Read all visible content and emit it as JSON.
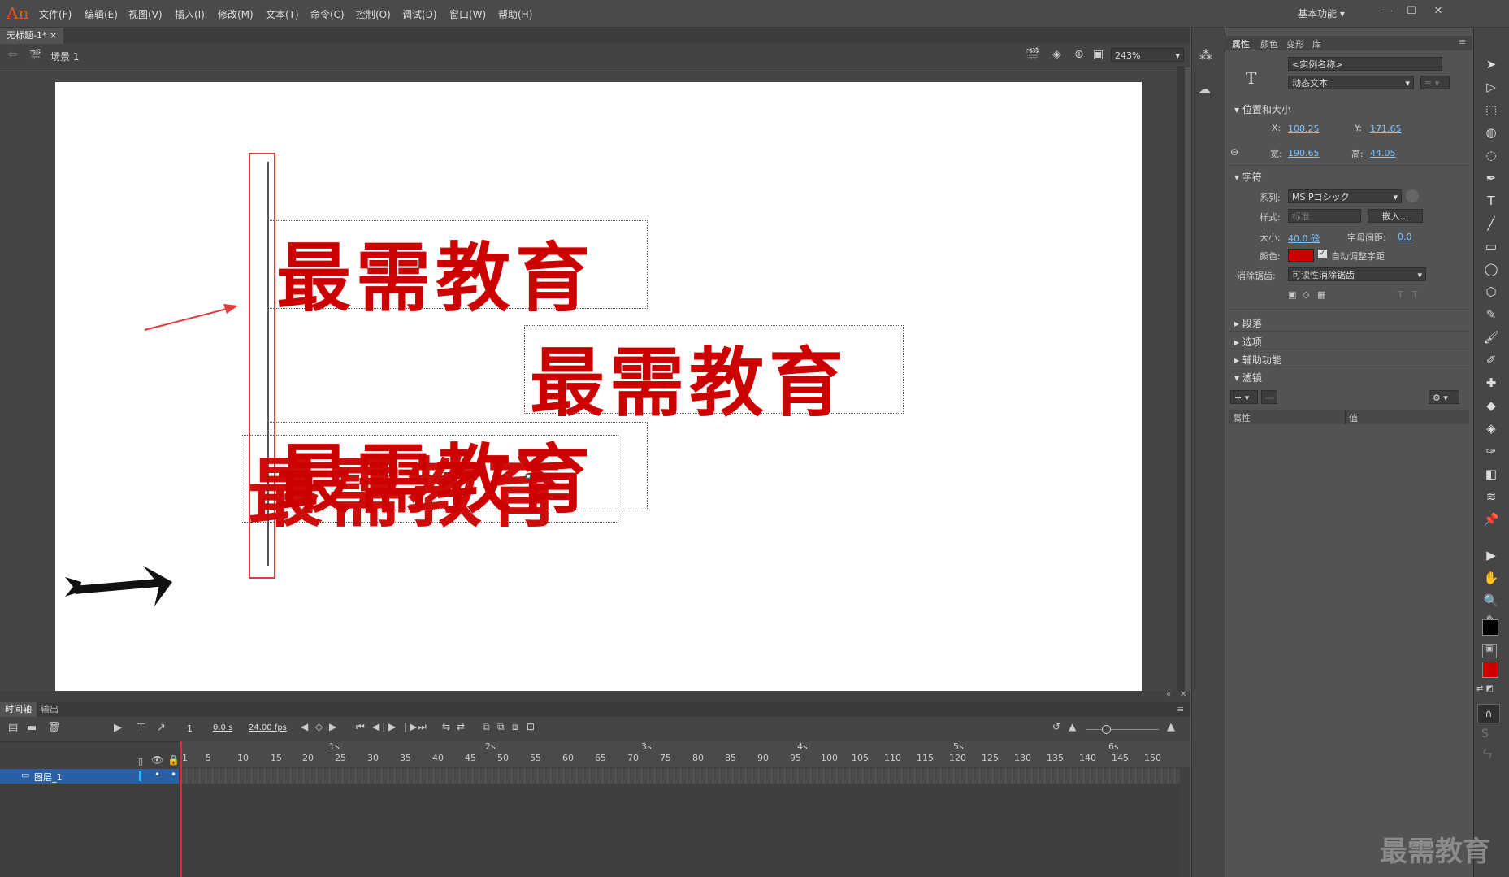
{
  "app": {
    "logo": "An"
  },
  "menu": [
    "文件(F)",
    "编辑(E)",
    "视图(V)",
    "插入(I)",
    "修改(M)",
    "文本(T)",
    "命令(C)",
    "控制(O)",
    "调试(D)",
    "窗口(W)",
    "帮助(H)"
  ],
  "workspace": "基本功能",
  "document": {
    "tab": "无标题-1*",
    "scene": "场景 1",
    "zoom": "243%"
  },
  "stage": {
    "text": "最需教育"
  },
  "timeline": {
    "tabs": [
      "时间轴",
      "输出"
    ],
    "frame": "1",
    "time": "0.0 s",
    "fps": "24.00 fps",
    "seconds": [
      "1s",
      "2s",
      "3s",
      "4s",
      "5s",
      "6s"
    ],
    "frame_ticks": [
      "1",
      "5",
      "10",
      "15",
      "20",
      "25",
      "30",
      "35",
      "40",
      "45",
      "50",
      "55",
      "60",
      "65",
      "70",
      "75",
      "80",
      "85",
      "90",
      "95",
      "100",
      "105",
      "110",
      "115",
      "120",
      "125",
      "130",
      "135",
      "140",
      "145",
      "150"
    ],
    "layer": "图层_1"
  },
  "panel": {
    "tabs": [
      "属性",
      "颜色",
      "变形",
      "库"
    ],
    "instance_name": "<实例名称>",
    "text_type": "动态文本",
    "pos_size": {
      "title": "位置和大小",
      "x_label": "X:",
      "x": "108.25",
      "y_label": "Y:",
      "y": "171.65",
      "w_label": "宽:",
      "w": "190.65",
      "h_label": "高:",
      "h": "44.05"
    },
    "char": {
      "title": "字符",
      "family_label": "系列:",
      "family": "MS Pゴシック",
      "style_label": "样式:",
      "style": "标准",
      "embed": "嵌入...",
      "size_label": "大小:",
      "size": "40.0 磅",
      "spacing_label": "字母间距:",
      "spacing": "0.0",
      "color_label": "颜色:",
      "color": "#cc0000",
      "autokern": "自动调整字距",
      "aa_label": "消除锯齿:",
      "aa": "可读性消除锯齿"
    },
    "sections": [
      "段落",
      "选项",
      "辅助功能"
    ],
    "filter": {
      "title": "滤镜",
      "col_prop": "属性",
      "col_val": "值"
    }
  },
  "watermark": "最需教育"
}
